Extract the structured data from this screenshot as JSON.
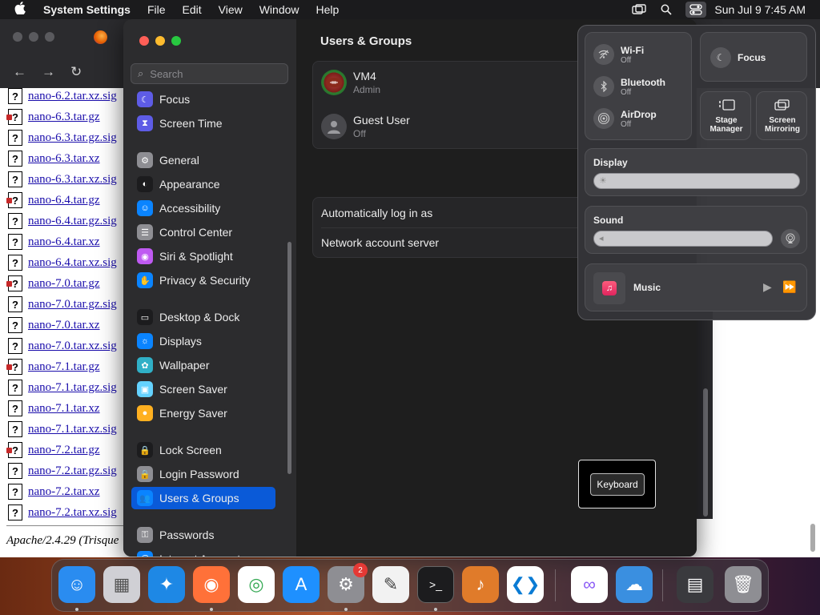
{
  "menubar": {
    "app_name": "System Settings",
    "items": [
      "File",
      "Edit",
      "View",
      "Window",
      "Help"
    ],
    "clock": "Sun Jul 9  7:45 AM"
  },
  "browser": {
    "files": [
      {
        "name": "nano-6.2.tar.xz.sig",
        "type": "unknown"
      },
      {
        "name": "nano-6.3.tar.gz",
        "type": "gz"
      },
      {
        "name": "nano-6.3.tar.gz.sig",
        "type": "unknown"
      },
      {
        "name": "nano-6.3.tar.xz",
        "type": "unknown"
      },
      {
        "name": "nano-6.3.tar.xz.sig",
        "type": "unknown"
      },
      {
        "name": "nano-6.4.tar.gz",
        "type": "gz"
      },
      {
        "name": "nano-6.4.tar.gz.sig",
        "type": "unknown"
      },
      {
        "name": "nano-6.4.tar.xz",
        "type": "unknown"
      },
      {
        "name": "nano-6.4.tar.xz.sig",
        "type": "unknown"
      },
      {
        "name": "nano-7.0.tar.gz",
        "type": "gz"
      },
      {
        "name": "nano-7.0.tar.gz.sig",
        "type": "unknown"
      },
      {
        "name": "nano-7.0.tar.xz",
        "type": "unknown"
      },
      {
        "name": "nano-7.0.tar.xz.sig",
        "type": "unknown"
      },
      {
        "name": "nano-7.1.tar.gz",
        "type": "gz"
      },
      {
        "name": "nano-7.1.tar.gz.sig",
        "type": "unknown"
      },
      {
        "name": "nano-7.1.tar.xz",
        "type": "unknown"
      },
      {
        "name": "nano-7.1.tar.xz.sig",
        "type": "unknown"
      },
      {
        "name": "nano-7.2.tar.gz",
        "type": "gz"
      },
      {
        "name": "nano-7.2.tar.gz.sig",
        "type": "unknown"
      },
      {
        "name": "nano-7.2.tar.xz",
        "type": "unknown"
      },
      {
        "name": "nano-7.2.tar.xz.sig",
        "type": "unknown"
      }
    ],
    "footer": "Apache/2.4.29 (Trisque"
  },
  "settings": {
    "search_placeholder": "Search",
    "sidebar": [
      {
        "label": "Focus",
        "color": "#5e5ce6",
        "icon": "moon-icon",
        "glyph": "☾"
      },
      {
        "label": "Screen Time",
        "color": "#5e5ce6",
        "icon": "hourglass-icon",
        "glyph": "⧗"
      },
      {
        "label": "General",
        "color": "#8e8e93",
        "icon": "gear-icon",
        "glyph": "⚙"
      },
      {
        "label": "Appearance",
        "color": "#1c1c1e",
        "icon": "appearance-icon",
        "glyph": "◐"
      },
      {
        "label": "Accessibility",
        "color": "#0a84ff",
        "icon": "accessibility-icon",
        "glyph": "☺"
      },
      {
        "label": "Control Center",
        "color": "#8e8e93",
        "icon": "control-center-icon",
        "glyph": "☰"
      },
      {
        "label": "Siri & Spotlight",
        "color": "#bf5af2",
        "icon": "siri-icon",
        "glyph": "◉"
      },
      {
        "label": "Privacy & Security",
        "color": "#0a84ff",
        "icon": "hand-icon",
        "glyph": "✋"
      },
      {
        "label": "Desktop & Dock",
        "color": "#1c1c1e",
        "icon": "dock-icon",
        "glyph": "▭"
      },
      {
        "label": "Displays",
        "color": "#0a84ff",
        "icon": "displays-icon",
        "glyph": "☼"
      },
      {
        "label": "Wallpaper",
        "color": "#30b0c7",
        "icon": "wallpaper-icon",
        "glyph": "✿"
      },
      {
        "label": "Screen Saver",
        "color": "#64d2ff",
        "icon": "screen-saver-icon",
        "glyph": "▣"
      },
      {
        "label": "Energy Saver",
        "color": "#ffb020",
        "icon": "energy-icon",
        "glyph": "●"
      },
      {
        "label": "Lock Screen",
        "color": "#1c1c1e",
        "icon": "lock-icon",
        "glyph": "🔒"
      },
      {
        "label": "Login Password",
        "color": "#8e8e93",
        "icon": "login-lock-icon",
        "glyph": "🔒"
      },
      {
        "label": "Users & Groups",
        "color": "#0a84ff",
        "icon": "users-icon",
        "glyph": "👥"
      },
      {
        "label": "Passwords",
        "color": "#8e8e93",
        "icon": "key-icon",
        "glyph": "⚿"
      },
      {
        "label": "Internet Accounts",
        "color": "#0a84ff",
        "icon": "at-icon",
        "glyph": "@"
      }
    ],
    "selected_index": 15,
    "content": {
      "title": "Users & Groups",
      "users": [
        {
          "name": "VM4",
          "role": "Admin"
        },
        {
          "name": "Guest User",
          "role": "Off"
        }
      ],
      "rows": [
        "Automatically log in as",
        "Network account server"
      ]
    }
  },
  "keyboard_popup": {
    "label": "Keyboard"
  },
  "control_center": {
    "wifi": {
      "label": "Wi-Fi",
      "status": "Off"
    },
    "bluetooth": {
      "label": "Bluetooth",
      "status": "Off"
    },
    "airdrop": {
      "label": "AirDrop",
      "status": "Off"
    },
    "focus": {
      "label": "Focus"
    },
    "stage_manager": {
      "label": "Stage Manager"
    },
    "screen_mirroring": {
      "label": "Screen Mirroring"
    },
    "display": {
      "label": "Display"
    },
    "sound": {
      "label": "Sound"
    },
    "music": {
      "label": "Music"
    }
  },
  "dock": {
    "apps": [
      {
        "name": "finder-icon",
        "color": "#2a8cf0"
      },
      {
        "name": "launchpad-icon",
        "color": "#d0d0d5"
      },
      {
        "name": "safari-icon",
        "color": "#1e88e5"
      },
      {
        "name": "firefox-icon",
        "color": "#ff7139"
      },
      {
        "name": "chrome-icon",
        "color": "#ffffff"
      },
      {
        "name": "app-store-icon",
        "color": "#1e90ff"
      },
      {
        "name": "system-settings-icon",
        "color": "#8e8e93"
      },
      {
        "name": "textedit-icon",
        "color": "#f2f2f2"
      },
      {
        "name": "terminal-icon",
        "color": "#1c1c1e"
      },
      {
        "name": "garageband-icon",
        "color": "#e07b2a"
      },
      {
        "name": "vscode-icon",
        "color": "#ffffff"
      },
      {
        "name": "visual-studio-icon",
        "color": "#ffffff"
      },
      {
        "name": "weather-icon",
        "color": "#3a8fe0"
      },
      {
        "name": "downloads-stack-icon",
        "color": "#3a3a3e"
      },
      {
        "name": "trash-icon",
        "color": "#8e8e93"
      }
    ],
    "settings_badge": "2"
  }
}
